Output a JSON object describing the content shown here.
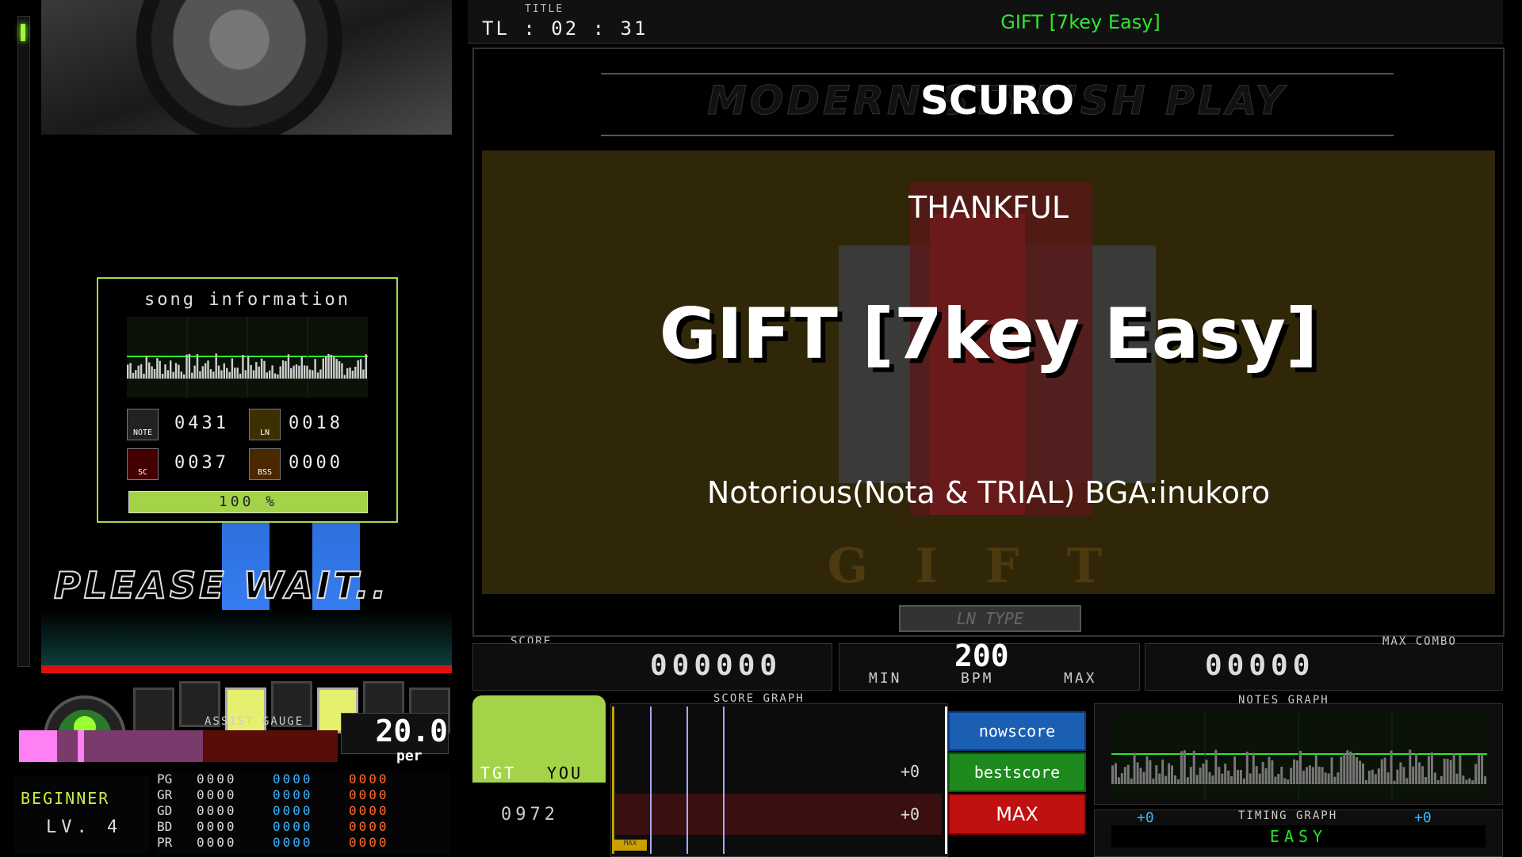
{
  "header": {
    "title_label": "TITLE",
    "timer": "TL : 02 : 31",
    "song_title": "GIFT [7key Easy]"
  },
  "bga": {
    "banner_overlay": "MODERN STYLISH PLAY",
    "banner_logo": "SCURO",
    "genre": "THANKFUL",
    "title": "GIFT [7key Easy]",
    "artist": "Notorious(Nota & TRIAL) BGA:inukoro",
    "background_text": "GIFT",
    "ln_type": "LN TYPE"
  },
  "lane": {
    "please_wait": "PLEASE WAIT..",
    "side_gauge_fill": 0.03
  },
  "song_info": {
    "title": "song information",
    "note_label": "NOTE",
    "ln_label": "LN",
    "scratch_label": "SC",
    "bss_label": "BSS",
    "note_count": "0431",
    "ln_count": "0018",
    "scratch_count": "0037",
    "bss_count": "0000",
    "progress": "100 %"
  },
  "assist": {
    "label": "ASSIST GAUGE",
    "value": "20.0",
    "unit": "per",
    "fill_fraction": 0.58
  },
  "difficulty": {
    "name": "BEGINNER",
    "level": "LV. 4"
  },
  "judges": [
    {
      "label": "PG",
      "c1": "0000",
      "c2": "0000",
      "c3": "0000"
    },
    {
      "label": "GR",
      "c1": "0000",
      "c2": "0000",
      "c3": "0000"
    },
    {
      "label": "GD",
      "c1": "0000",
      "c2": "0000",
      "c3": "0000"
    },
    {
      "label": "BD",
      "c1": "0000",
      "c2": "0000",
      "c3": "0000"
    },
    {
      "label": "PR",
      "c1": "0000",
      "c2": "0000",
      "c3": "0000"
    }
  ],
  "score": {
    "label": "SCORE",
    "value": "000000",
    "bpm": "200",
    "bpm_min": "MIN",
    "bpm_label": "BPM",
    "bpm_max": "MAX",
    "combo_label": "MAX COMBO",
    "combo_value": "00000"
  },
  "score_graph": {
    "label": "SCORE GRAPH",
    "tgt": "TGT",
    "you": "YOU",
    "target_score": "0972",
    "diff_best": "+0",
    "diff_target": "+0",
    "now_score": "nowscore",
    "best_score": "bestscore",
    "max": "MAX",
    "max_marker": "MAX"
  },
  "notes_graph": {
    "label": "NOTES GRAPH",
    "timing_label": "TIMING GRAPH",
    "timing_left": "+0",
    "timing_right": "+0",
    "gauge_type": "EASY"
  },
  "colors": {
    "accent_green": "#a4d34a",
    "title_green": "#2ee82e",
    "judge_blue": "#39b4ff",
    "judge_orange": "#ff6b2b",
    "assist_pink": "#ff7ff5"
  }
}
